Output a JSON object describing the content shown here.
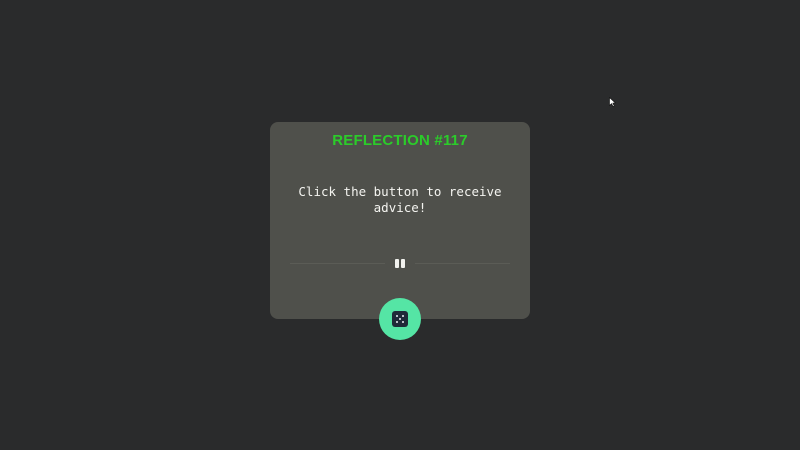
{
  "card": {
    "title": "REFLECTION #117",
    "advice": "Click the button to receive advice!"
  },
  "icons": {
    "divider": "pause-icon",
    "button": "dice-icon",
    "cursor": "mouse-pointer-icon"
  },
  "colors": {
    "background": "#2a2b2c",
    "card": "#4f504b",
    "title": "#2bcc2a",
    "text": "#f4f4f0",
    "button": "#55e5a5",
    "dice": "#1f2a38"
  }
}
